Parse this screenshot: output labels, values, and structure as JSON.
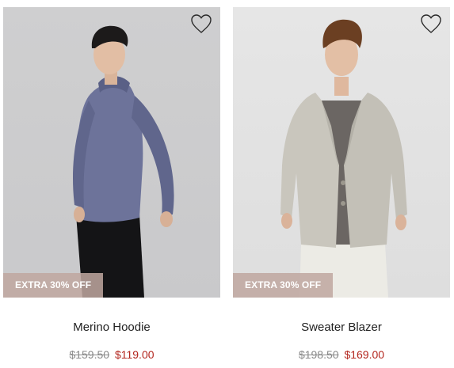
{
  "products": [
    {
      "name": "Merino Hoodie",
      "original_price": "$159.50",
      "sale_price": "$119.00",
      "badge": "EXTRA 30% OFF",
      "wishlist_icon": "heart-outline-icon"
    },
    {
      "name": "Sweater Blazer",
      "original_price": "$198.50",
      "sale_price": "$169.00",
      "badge": "EXTRA 30% OFF",
      "wishlist_icon": "heart-outline-icon"
    }
  ],
  "colors": {
    "badge_bg": "#c0a7a0",
    "sale_price": "#b3261e",
    "original_price": "#8a8a8a"
  }
}
